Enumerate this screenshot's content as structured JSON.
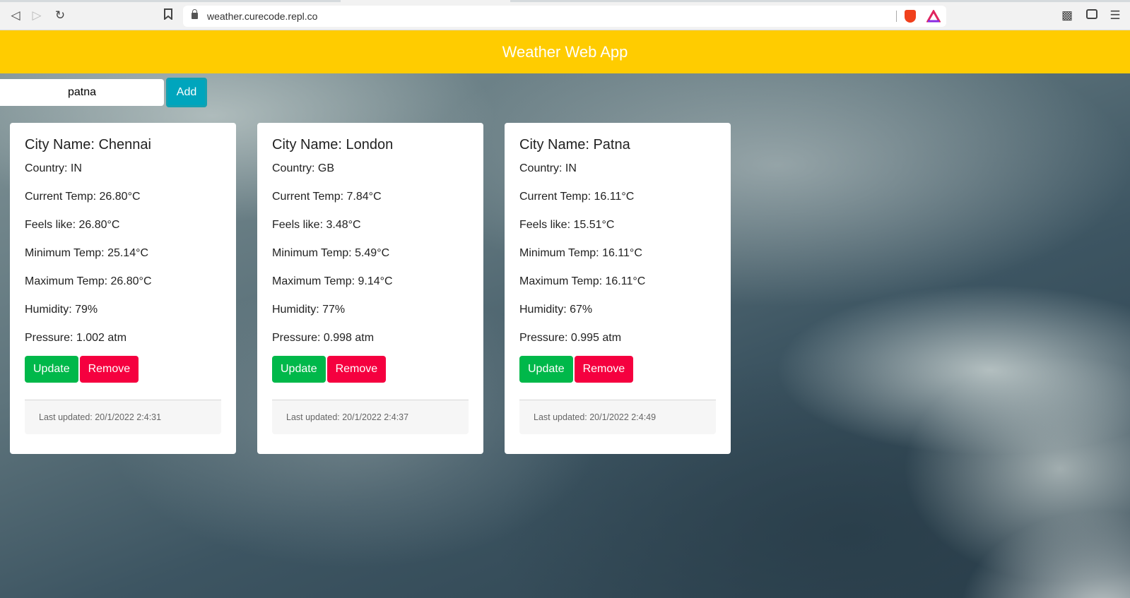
{
  "browser": {
    "url": "weather.curecode.repl.co",
    "icons": [
      "back-icon",
      "forward-icon",
      "reload-icon",
      "bookmark-icon",
      "lock-icon",
      "brave-shield-icon",
      "brave-rewards-icon",
      "extensions-icon",
      "wallet-icon",
      "menu-icon"
    ]
  },
  "header": {
    "title": "Weather Web App",
    "color": "#ffcc00"
  },
  "search": {
    "value": "patna",
    "add_label": "Add"
  },
  "cards": [
    {
      "title": "City Name: Chennai",
      "country": "Country: IN",
      "current": "Current Temp: 26.80°C",
      "feels": "Feels like: 26.80°C",
      "min": "Minimum Temp: 25.14°C",
      "max": "Maximum Temp: 26.80°C",
      "humidity": "Humidity: 79%",
      "pressure": "Pressure: 1.002 atm",
      "update": "Update",
      "remove": "Remove",
      "updated": "Last updated: 20/1/2022 2:4:31"
    },
    {
      "title": "City Name: London",
      "country": "Country: GB",
      "current": "Current Temp: 7.84°C",
      "feels": "Feels like: 3.48°C",
      "min": "Minimum Temp: 5.49°C",
      "max": "Maximum Temp: 9.14°C",
      "humidity": "Humidity: 77%",
      "pressure": "Pressure: 0.998 atm",
      "update": "Update",
      "remove": "Remove",
      "updated": "Last updated: 20/1/2022 2:4:37"
    },
    {
      "title": "City Name: Patna",
      "country": "Country: IN",
      "current": "Current Temp: 16.11°C",
      "feels": "Feels like: 15.51°C",
      "min": "Minimum Temp: 16.11°C",
      "max": "Maximum Temp: 16.11°C",
      "humidity": "Humidity: 67%",
      "pressure": "Pressure: 0.995 atm",
      "update": "Update",
      "remove": "Remove",
      "updated": "Last updated: 20/1/2022 2:4:49"
    }
  ],
  "colors": {
    "update": "#00b84a",
    "remove": "#f5003f",
    "add": "#00a5bd"
  }
}
